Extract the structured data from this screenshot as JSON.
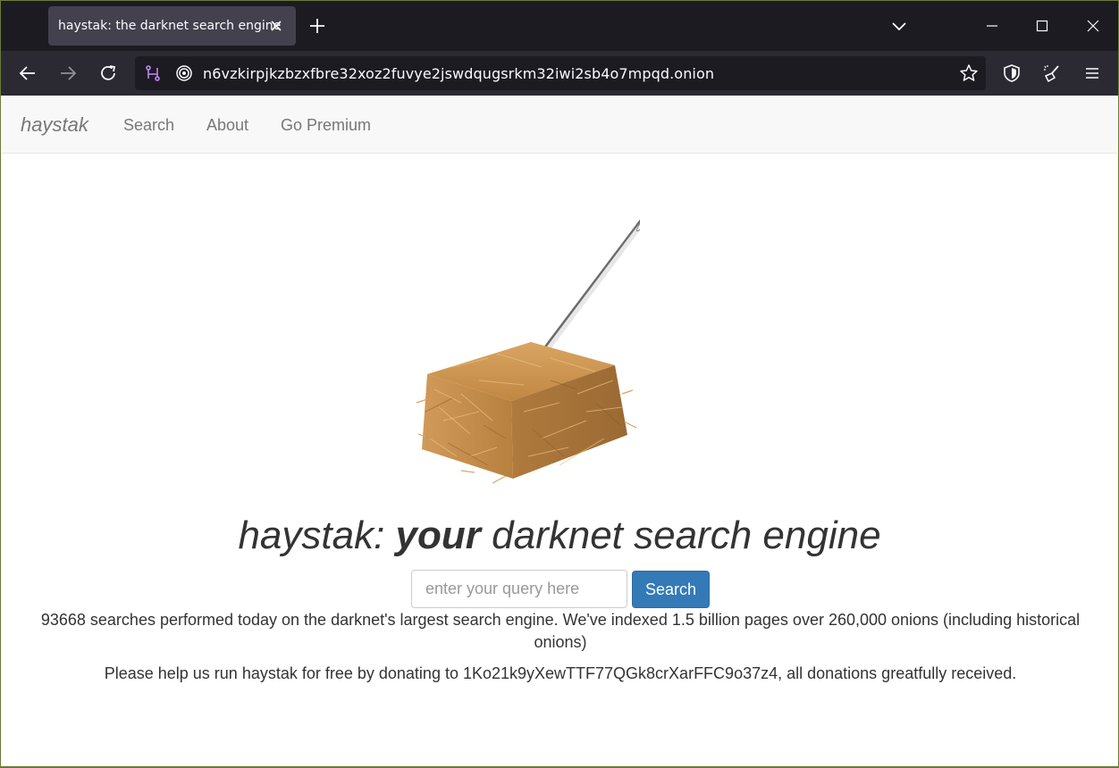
{
  "browser": {
    "tab_title": "haystak: the darknet search engine",
    "url": "n6vzkirpjkzbzxfbre32xoz2fuvye2jswdqugsrkm32iwi2sb4o7mpqd.onion",
    "icons": [
      "close-icon",
      "plus-icon",
      "chevron-down-icon",
      "minimize-icon",
      "maximize-icon",
      "window-close-icon",
      "back-icon",
      "forward-icon",
      "reload-icon",
      "onion-circuit-icon",
      "onion-site-icon",
      "bookmark-star-icon",
      "shield-icon",
      "broom-icon",
      "menu-icon"
    ]
  },
  "nav": {
    "brand": "haystak",
    "links": [
      "Search",
      "About",
      "Go Premium"
    ]
  },
  "main": {
    "headline_pre": "haystak: ",
    "headline_bold": "your",
    "headline_post": " darknet search engine",
    "search_placeholder": "enter your query here",
    "search_button": "Search",
    "stats_text": "93668 searches performed today on the darknet's largest search engine. We've indexed 1.5 billion pages over 260,000 onions (including historical onions)",
    "donate_text": "Please help us run haystak for free by donating to 1Ko21k9yXewTTF77QGk8crXarFFC9o37z4, all donations greatfully received."
  },
  "colors": {
    "tabstrip": "#1c1b22",
    "toolbar": "#2b2a33",
    "primary_button": "#337ab7"
  }
}
